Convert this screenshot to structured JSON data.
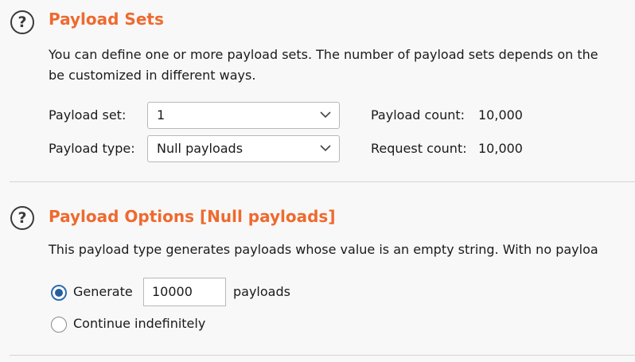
{
  "payload_sets": {
    "title": "Payload Sets",
    "help_icon_glyph": "?",
    "description_line1": "You can define one or more payload sets. The number of payload sets depends on the",
    "description_line2": "be customized in different ways.",
    "payload_set_label": "Payload set:",
    "payload_set_value": "1",
    "payload_type_label": "Payload type:",
    "payload_type_value": "Null payloads",
    "payload_count_label": "Payload count:",
    "payload_count_value": "10,000",
    "request_count_label": "Request count:",
    "request_count_value": "10,000"
  },
  "payload_options": {
    "title": "Payload Options [Null payloads]",
    "help_icon_glyph": "?",
    "description": "This payload type generates payloads whose value is an empty string. With no payloa",
    "generate_label": "Generate",
    "generate_value": "10000",
    "payloads_suffix": "payloads",
    "generate_selected": true,
    "continue_label": "Continue indefinitely",
    "continue_selected": false
  },
  "colors": {
    "accent_title": "#ee6a2f",
    "radio_selected": "#235f9c",
    "background": "#f8f8f8"
  }
}
